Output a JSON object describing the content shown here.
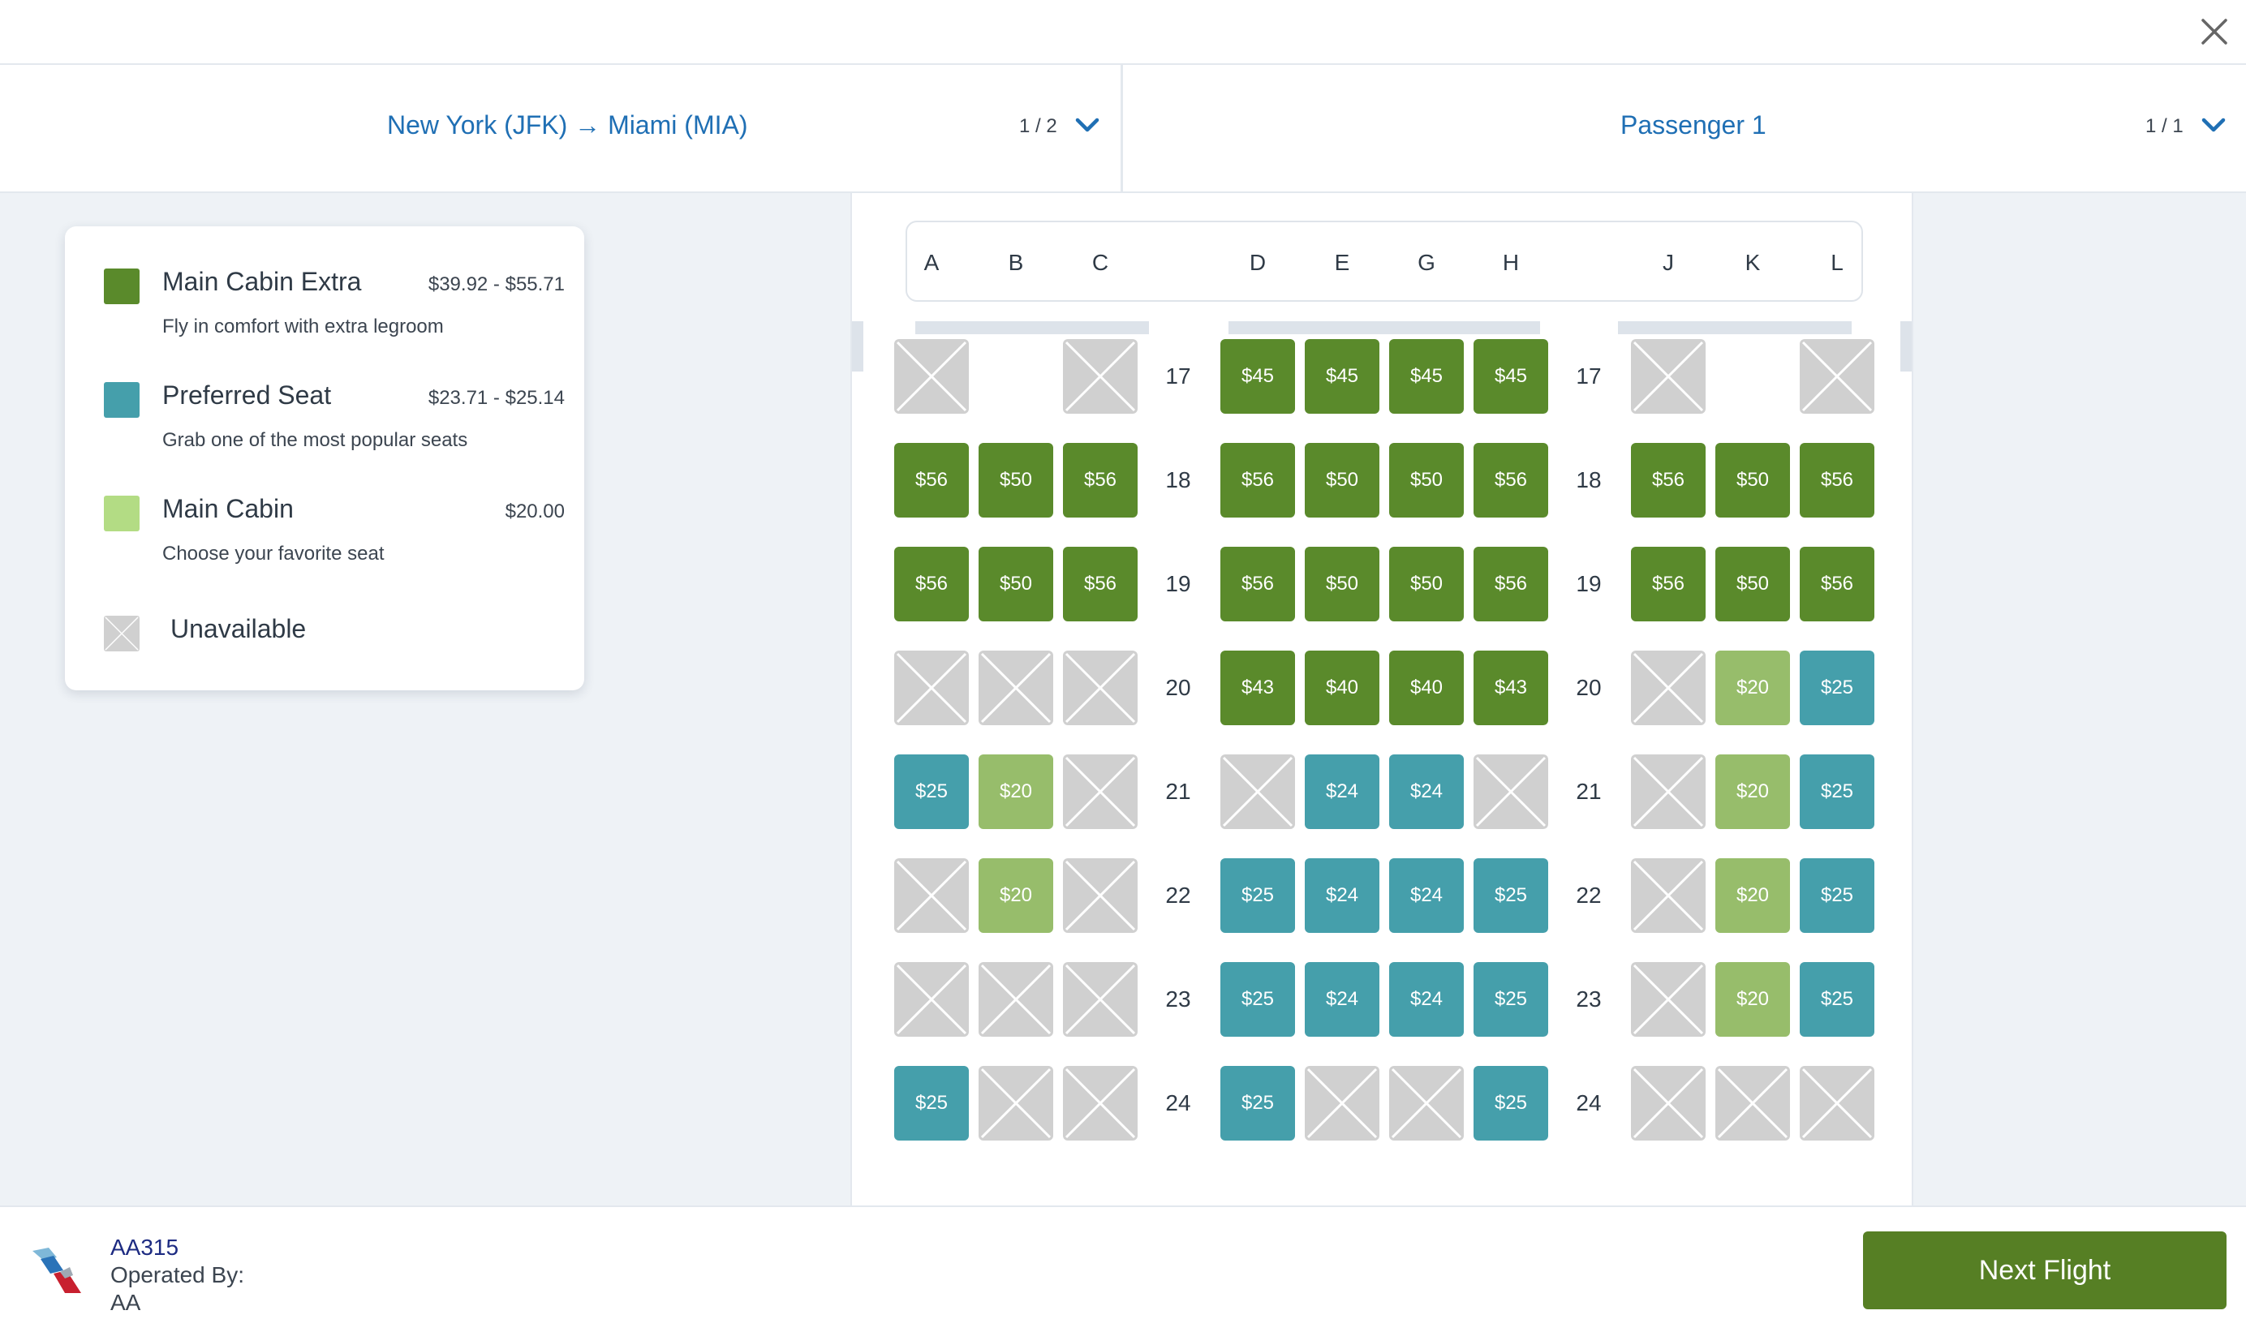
{
  "header": {
    "close_icon": "close-icon"
  },
  "selectors": {
    "flight": {
      "label": "New York (JFK) → Miami (MIA)",
      "count": "1 / 2",
      "icon": "chevron-down-icon"
    },
    "passenger": {
      "label": "Passenger 1",
      "count": "1 / 1",
      "icon": "chevron-down-icon"
    }
  },
  "legend": [
    {
      "name": "Main Cabin Extra",
      "price": "$39.92 - $55.71",
      "desc": "Fly in comfort with extra legroom",
      "color": "#5a8a2b"
    },
    {
      "name": "Preferred Seat",
      "price": "$23.71 - $25.14",
      "desc": "Grab one of the most popular seats",
      "color": "#459fab"
    },
    {
      "name": "Main Cabin",
      "price": "$20.00",
      "desc": "Choose your favorite seat",
      "color": "#b3dc84"
    },
    {
      "name": "Unavailable",
      "price": "",
      "desc": "",
      "color": "#d0d0d0"
    }
  ],
  "seat_map": {
    "columns": [
      "A",
      "B",
      "C",
      "D",
      "E",
      "G",
      "H",
      "J",
      "K",
      "L"
    ],
    "rows": [
      {
        "number": "17",
        "seats": [
          {
            "t": "na"
          },
          {
            "t": "none"
          },
          {
            "t": "na"
          },
          {
            "t": "mce",
            "p": "$45"
          },
          {
            "t": "mce",
            "p": "$45"
          },
          {
            "t": "mce",
            "p": "$45"
          },
          {
            "t": "mce",
            "p": "$45"
          },
          {
            "t": "na"
          },
          {
            "t": "none"
          },
          {
            "t": "na"
          }
        ]
      },
      {
        "number": "18",
        "seats": [
          {
            "t": "mce",
            "p": "$56"
          },
          {
            "t": "mce",
            "p": "$50"
          },
          {
            "t": "mce",
            "p": "$56"
          },
          {
            "t": "mce",
            "p": "$56"
          },
          {
            "t": "mce",
            "p": "$50"
          },
          {
            "t": "mce",
            "p": "$50"
          },
          {
            "t": "mce",
            "p": "$56"
          },
          {
            "t": "mce",
            "p": "$56"
          },
          {
            "t": "mce",
            "p": "$50"
          },
          {
            "t": "mce",
            "p": "$56"
          }
        ]
      },
      {
        "number": "19",
        "seats": [
          {
            "t": "mce",
            "p": "$56"
          },
          {
            "t": "mce",
            "p": "$50"
          },
          {
            "t": "mce",
            "p": "$56"
          },
          {
            "t": "mce",
            "p": "$56"
          },
          {
            "t": "mce",
            "p": "$50"
          },
          {
            "t": "mce",
            "p": "$50"
          },
          {
            "t": "mce",
            "p": "$56"
          },
          {
            "t": "mce",
            "p": "$56"
          },
          {
            "t": "mce",
            "p": "$50"
          },
          {
            "t": "mce",
            "p": "$56"
          }
        ]
      },
      {
        "number": "20",
        "seats": [
          {
            "t": "na"
          },
          {
            "t": "na"
          },
          {
            "t": "na"
          },
          {
            "t": "mce",
            "p": "$43"
          },
          {
            "t": "mce",
            "p": "$40"
          },
          {
            "t": "mce",
            "p": "$40"
          },
          {
            "t": "mce",
            "p": "$43"
          },
          {
            "t": "na"
          },
          {
            "t": "main",
            "p": "$20"
          },
          {
            "t": "pref",
            "p": "$25"
          }
        ]
      },
      {
        "number": "21",
        "seats": [
          {
            "t": "pref",
            "p": "$25"
          },
          {
            "t": "main",
            "p": "$20"
          },
          {
            "t": "na"
          },
          {
            "t": "na"
          },
          {
            "t": "pref",
            "p": "$24"
          },
          {
            "t": "pref",
            "p": "$24"
          },
          {
            "t": "na"
          },
          {
            "t": "na"
          },
          {
            "t": "main",
            "p": "$20"
          },
          {
            "t": "pref",
            "p": "$25"
          }
        ]
      },
      {
        "number": "22",
        "seats": [
          {
            "t": "na"
          },
          {
            "t": "main",
            "p": "$20"
          },
          {
            "t": "na"
          },
          {
            "t": "pref",
            "p": "$25"
          },
          {
            "t": "pref",
            "p": "$24"
          },
          {
            "t": "pref",
            "p": "$24"
          },
          {
            "t": "pref",
            "p": "$25"
          },
          {
            "t": "na"
          },
          {
            "t": "main",
            "p": "$20"
          },
          {
            "t": "pref",
            "p": "$25"
          }
        ]
      },
      {
        "number": "23",
        "seats": [
          {
            "t": "na"
          },
          {
            "t": "na"
          },
          {
            "t": "na"
          },
          {
            "t": "pref",
            "p": "$25"
          },
          {
            "t": "pref",
            "p": "$24"
          },
          {
            "t": "pref",
            "p": "$24"
          },
          {
            "t": "pref",
            "p": "$25"
          },
          {
            "t": "na"
          },
          {
            "t": "main",
            "p": "$20"
          },
          {
            "t": "pref",
            "p": "$25"
          }
        ]
      },
      {
        "number": "24",
        "seats": [
          {
            "t": "pref",
            "p": "$25"
          },
          {
            "t": "na"
          },
          {
            "t": "na"
          },
          {
            "t": "pref",
            "p": "$25"
          },
          {
            "t": "na"
          },
          {
            "t": "na"
          },
          {
            "t": "pref",
            "p": "$25"
          },
          {
            "t": "na"
          },
          {
            "t": "na"
          },
          {
            "t": "na"
          }
        ]
      }
    ]
  },
  "footer": {
    "flight_number": "AA315",
    "operated_label": "Operated By:",
    "operator": "AA",
    "logo_icon": "airline-logo-icon",
    "next_button": "Next Flight"
  }
}
